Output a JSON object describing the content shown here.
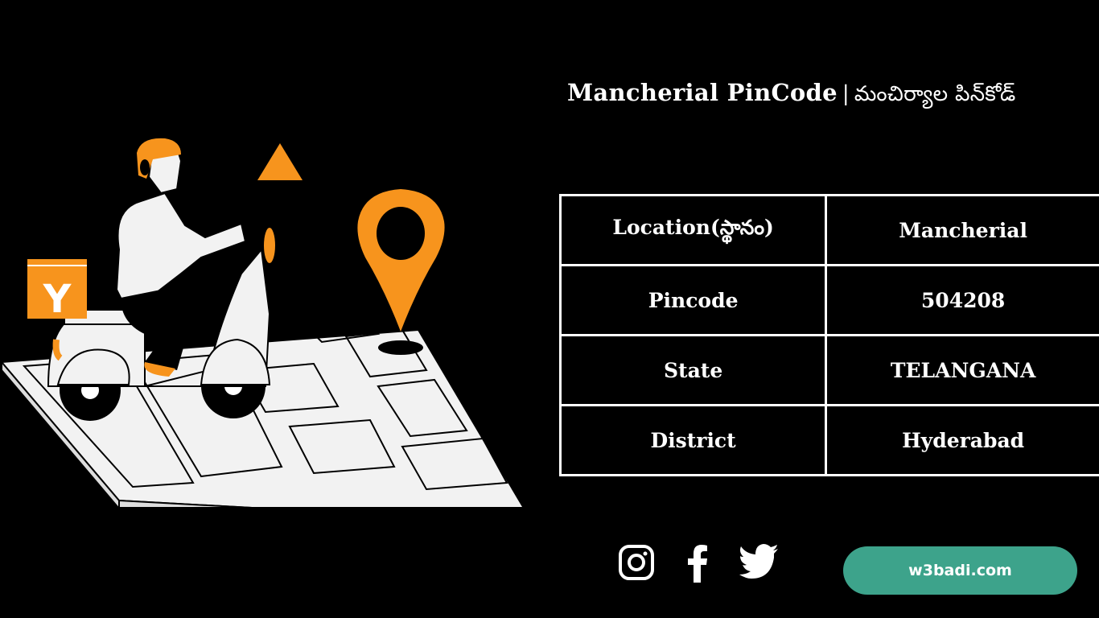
{
  "title": {
    "english": "Mancherial PinCode",
    "separator": "|",
    "telugu": "మంచిర్యాల పిన్‌కోడ్"
  },
  "illustration": {
    "description": "Delivery rider on scooter over a city map with location pin",
    "box_letter": "Y",
    "accent_color": "#f7941d",
    "map_color": "#f2f2f2"
  },
  "table": {
    "rows": [
      {
        "label": "Location(స్థానం)",
        "value": "Mancherial"
      },
      {
        "label": "Pincode",
        "value": "504208"
      },
      {
        "label": "State",
        "value": "TELANGANA"
      },
      {
        "label": "District",
        "value": "Hyderabad"
      }
    ]
  },
  "social": {
    "icons": [
      "instagram-icon",
      "facebook-icon",
      "twitter-icon"
    ]
  },
  "website_button": {
    "label": "w3badi.com",
    "color": "#3da38b"
  }
}
